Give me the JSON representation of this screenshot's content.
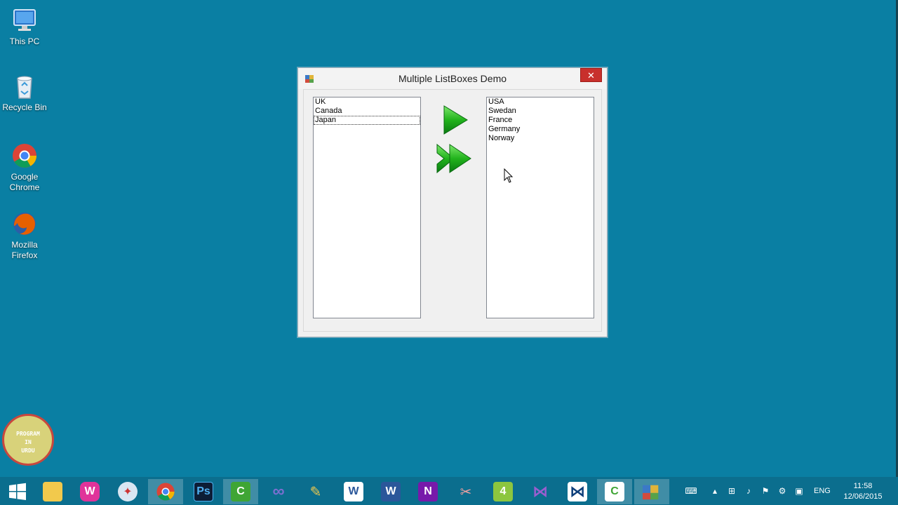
{
  "desktop": {
    "icons": [
      {
        "label": "This PC",
        "icon": "computer-icon"
      },
      {
        "label": "Recycle Bin",
        "icon": "recycle-bin-icon"
      },
      {
        "label": "Google Chrome",
        "icon": "chrome-icon"
      },
      {
        "label": "Mozilla Firefox",
        "icon": "firefox-icon"
      }
    ],
    "background_color": "#0a7fa3"
  },
  "window": {
    "title": "Multiple ListBoxes Demo",
    "close_label": "✕",
    "left_list": {
      "items": [
        "UK",
        "Canada",
        "Japan"
      ],
      "focused_index": 2
    },
    "right_list": {
      "items": [
        "USA",
        "Swedan",
        "France",
        "Germany",
        "Norway"
      ]
    },
    "buttons": {
      "move_one": "move-one-arrow-icon",
      "move_all": "move-all-arrow-icon"
    }
  },
  "badge": {
    "lines": [
      "PROGRAM",
      "IN",
      "URDU"
    ]
  },
  "taskbar": {
    "items": [
      {
        "name": "start-button",
        "icon": "windows-logo-icon"
      },
      {
        "name": "file-explorer",
        "icon": "folder-icon"
      },
      {
        "name": "wamp",
        "icon": "wamp-icon"
      },
      {
        "name": "safari",
        "icon": "compass-icon"
      },
      {
        "name": "chrome",
        "icon": "chrome-icon"
      },
      {
        "name": "photoshop",
        "icon": "photoshop-icon",
        "text": "Ps"
      },
      {
        "name": "camtasia",
        "icon": "camtasia-icon",
        "text": "C"
      },
      {
        "name": "eclipse",
        "icon": "infinity-icon"
      },
      {
        "name": "tools",
        "icon": "tools-icon"
      },
      {
        "name": "word",
        "icon": "word-icon",
        "text": "W"
      },
      {
        "name": "word-2",
        "icon": "word-icon",
        "text": "W"
      },
      {
        "name": "onenote",
        "icon": "onenote-icon",
        "text": "N"
      },
      {
        "name": "snipping-tool",
        "icon": "scissors-icon"
      },
      {
        "name": "notepad",
        "icon": "notepad-icon",
        "text": "4"
      },
      {
        "name": "visual-studio",
        "icon": "visual-studio-icon"
      },
      {
        "name": "visual-studio-2",
        "icon": "visual-studio-icon"
      },
      {
        "name": "camtasia-2",
        "icon": "camtasia-icon",
        "text": "C"
      },
      {
        "name": "running-app",
        "icon": "app-icon"
      }
    ],
    "tray": {
      "language": "ENG",
      "time": "11:58",
      "date": "12/06/2015"
    }
  }
}
